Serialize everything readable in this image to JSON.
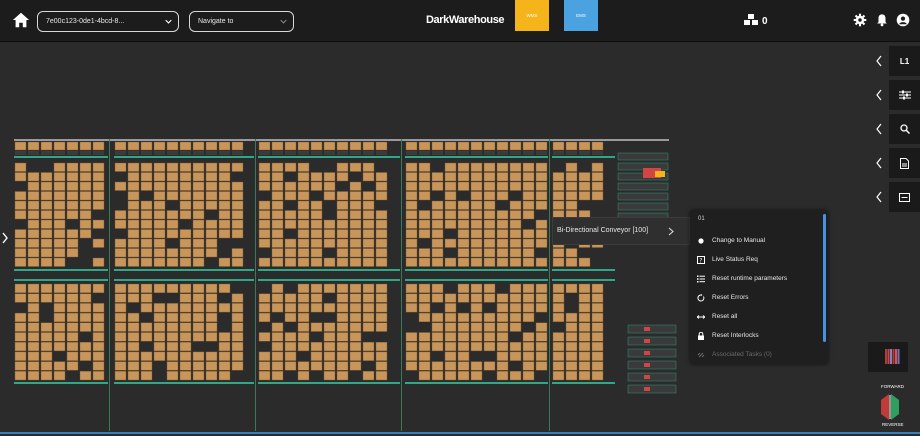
{
  "header": {
    "device_select": {
      "value": "7e00c123-0de1-4bcd-8..."
    },
    "navigate_select": {
      "placeholder": "Navigate to"
    },
    "brand": "DarkWarehouse",
    "tag_yellow": "WMS",
    "tag_blue": "EMS",
    "bin_count": "0"
  },
  "side_panel": {
    "tabs": [
      {
        "name": "level",
        "label": "L1",
        "icon": "level-label"
      },
      {
        "name": "filters",
        "label": "",
        "icon": "sliders-icon"
      },
      {
        "name": "search",
        "label": "",
        "icon": "search-icon"
      },
      {
        "name": "document",
        "label": "",
        "icon": "document-icon"
      },
      {
        "name": "screen",
        "label": "",
        "icon": "monitor-icon"
      }
    ]
  },
  "popup": {
    "conveyor_label": "Bi-Directional Conveyor [100]",
    "menu_header": "01",
    "items": [
      {
        "label": "Change to Manual",
        "icon": "dot-icon",
        "enabled": true
      },
      {
        "label": "Live Status Req",
        "icon": "status-icon",
        "enabled": true
      },
      {
        "label": "Reset runtime parameters",
        "icon": "list-icon",
        "enabled": true
      },
      {
        "label": "Reset Errors",
        "icon": "reset-icon",
        "enabled": true
      },
      {
        "label": "Reset all",
        "icon": "arrows-icon",
        "enabled": true
      },
      {
        "label": "Reset Interlocks",
        "icon": "lock-icon",
        "enabled": true
      },
      {
        "label": "Associated Tasks (0)",
        "icon": "link-icon",
        "enabled": false
      }
    ]
  },
  "direction": {
    "forward": "FORWARD",
    "reverse": "REVERSE"
  },
  "colors": {
    "bin": "#c8955a",
    "rail": "#2fa88a",
    "accent_blue": "#4a90e2",
    "yellow": "#f4b41a"
  }
}
